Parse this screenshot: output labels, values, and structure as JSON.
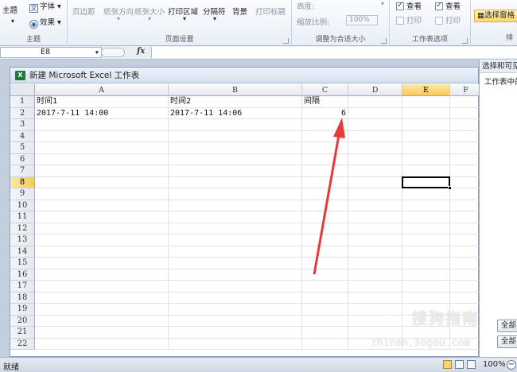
{
  "ribbon": {
    "theme_group": {
      "theme_label": "主题",
      "font_label": "字体",
      "effects_label": "效果",
      "group_label": "主题"
    },
    "page_setup": {
      "margins": "页边距",
      "orientation": "纸张方向",
      "size": "纸张大小",
      "print_area": "打印区域",
      "breaks": "分隔符",
      "background": "背景",
      "print_titles": "打印标题",
      "group_label": "页面设置"
    },
    "scale": {
      "height_label": "高度:",
      "zoom_label": "缩放比例:",
      "zoom_value": "100%",
      "group_label": "调整为合适大小"
    },
    "sheet_options": {
      "view1": "查看",
      "print1": "打印",
      "view2": "查看",
      "print2": "打印",
      "group_label": "工作表选项"
    },
    "arrange": {
      "selection_pane": "选择窗格",
      "group_label": "排"
    }
  },
  "formula_bar": {
    "name_box": "E8",
    "fx": "fx",
    "content": ""
  },
  "workbook": {
    "title": "新建 Microsoft Excel 工作表",
    "columns": [
      {
        "label": "A",
        "active": false
      },
      {
        "label": "B",
        "active": false
      },
      {
        "label": "C",
        "active": false
      },
      {
        "label": "D",
        "active": false
      },
      {
        "label": "E",
        "active": true
      },
      {
        "label": "F",
        "active": false
      }
    ],
    "rows": [
      "1",
      "2",
      "3",
      "4",
      "5",
      "6",
      "7",
      "8",
      "9",
      "10",
      "11",
      "12",
      "13",
      "14",
      "15",
      "16",
      "17",
      "18",
      "19",
      "20",
      "21",
      "22"
    ],
    "active_row": "8",
    "cells": {
      "A1": "时间1",
      "B1": "时间2",
      "C1": "间隔",
      "A2": "2017-7-11 14:00",
      "B2": "2017-7-11 14:06",
      "C2": "6"
    }
  },
  "task_pane": {
    "title": "选择和可见",
    "subtitle": "工作表中的",
    "show_all": "全部",
    "hide_all": "全部"
  },
  "status_bar": {
    "status": "就绪",
    "zoom": "100%"
  },
  "watermark": {
    "brand": "搜狗指南",
    "url": "zhinan.sogou.com"
  },
  "colors": {
    "accent_header": "#f8c95a",
    "arrow": "#e8383a",
    "excel_green": "#1e7a3a"
  }
}
